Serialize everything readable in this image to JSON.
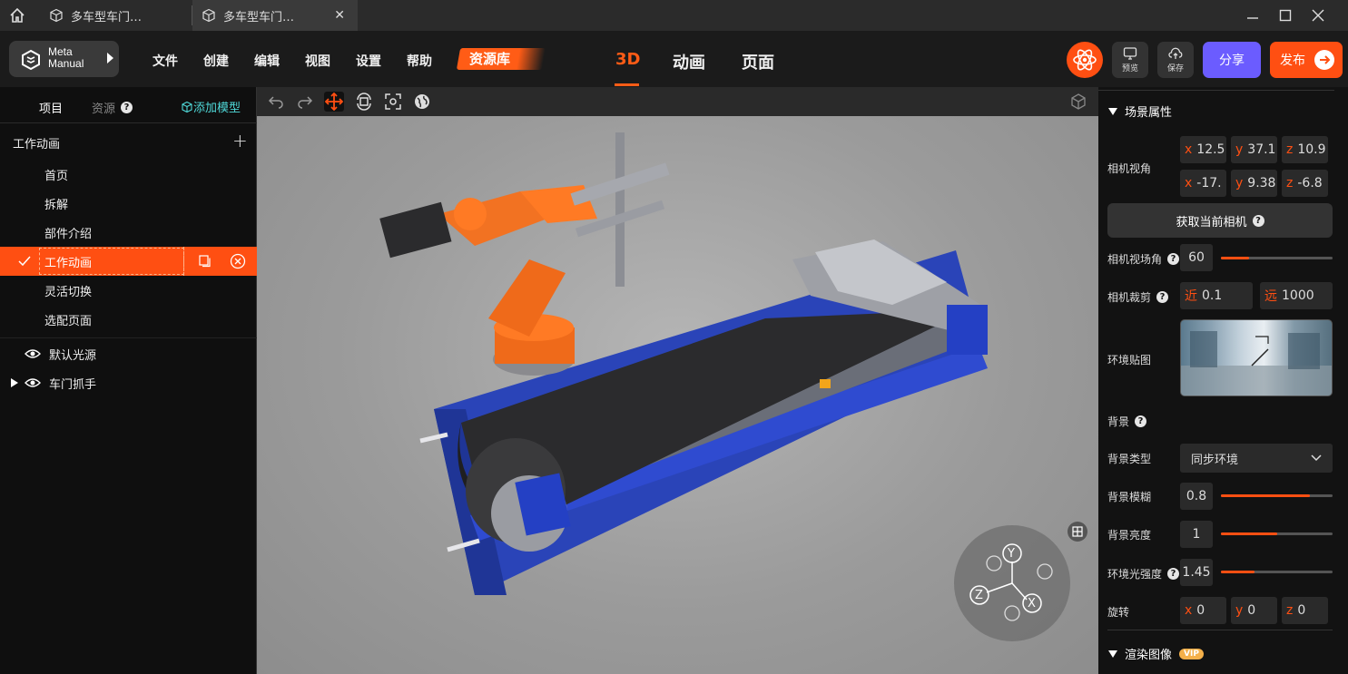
{
  "tabs": [
    {
      "label": "多车型车门…"
    },
    {
      "label": "多车型车门…"
    }
  ],
  "logo": {
    "line1": "Meta",
    "line2": "Manual"
  },
  "menu": {
    "file": "文件",
    "create": "创建",
    "edit": "编辑",
    "view": "视图",
    "settings": "设置",
    "help": "帮助",
    "resources": "资源库"
  },
  "modes": {
    "d3": "3D",
    "animation": "动画",
    "page": "页面"
  },
  "toolbar": {
    "preview": "预览",
    "save": "保存",
    "share": "分享",
    "publish": "发布"
  },
  "left": {
    "tab_project": "项目",
    "tab_resources": "资源",
    "add_model": "添加模型",
    "group_title": "工作动画",
    "items": [
      "首页",
      "拆解",
      "部件介绍",
      "工作动画",
      "灵活切换",
      "选配页面"
    ],
    "scene_items": [
      "默认光源",
      "车门抓手"
    ]
  },
  "right": {
    "scene_props": "场景属性",
    "camera_view": "相机视角",
    "cam_pos": {
      "x": "12.5",
      "y": "37.1",
      "z": "10.9"
    },
    "cam_target": {
      "x": "-17.",
      "y": "9.38",
      "z": "-6.8"
    },
    "axis_x": "x",
    "axis_y": "y",
    "axis_z": "z",
    "get_camera": "获取当前相机",
    "fov_label": "相机视场角",
    "fov": "60",
    "fov_level": 0.25,
    "clip_label": "相机裁剪",
    "near_label": "近",
    "near": "0.1",
    "far_label": "远",
    "far": "1000",
    "env_map": "环境贴图",
    "background": "背景",
    "bg_type_label": "背景类型",
    "bg_type": "同步环境",
    "bg_blur_label": "背景模糊",
    "bg_blur": "0.8",
    "bg_blur_level": 0.8,
    "bg_bright_label": "背景亮度",
    "bg_bright": "1",
    "bg_bright_level": 0.5,
    "env_light_label": "环境光强度",
    "env_light": "1.45",
    "env_light_level": 0.3,
    "rotate_label": "旋转",
    "rot": {
      "x": "0",
      "y": "0",
      "z": "0"
    },
    "render_image": "渲染图像",
    "vip": "VIP"
  },
  "gizmo": {
    "y": "Y",
    "z": "Z",
    "x": "X"
  },
  "colors": {
    "accent": "#ff4f12",
    "share": "#6b5cff",
    "add_model": "#4fd8d8"
  }
}
